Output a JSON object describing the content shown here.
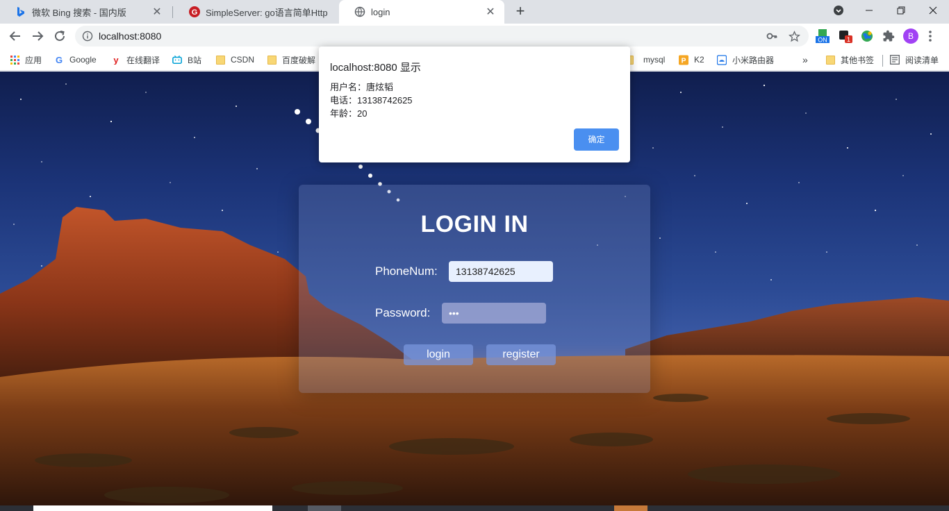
{
  "tabs": [
    {
      "title": "微软 Bing 搜索 - 国内版"
    },
    {
      "title": "SimpleServer: go语言简单Http"
    },
    {
      "title": "login"
    }
  ],
  "toolbar": {
    "url": "localhost:8080"
  },
  "bookmarks": [
    "应用",
    "Google",
    "在线翻译",
    "B站",
    "CSDN",
    "百度破解",
    "mysql",
    "K2",
    "小米路由器",
    "其他书签",
    "阅读清单"
  ],
  "extensions": {
    "on_badge": "ON",
    "notif_count": "1",
    "profile_initial": "B"
  },
  "dialog": {
    "title": "localhost:8080 显示",
    "lines": [
      "用户名：唐炫韬",
      "电话：13138742625",
      "年龄：20"
    ],
    "ok_label": "确定"
  },
  "login": {
    "title": "LOGIN IN",
    "phone_label": "PhoneNum:",
    "phone_value": "13138742625",
    "password_label": "Password:",
    "password_value": "•••",
    "login_button": "login",
    "register_button": "register"
  }
}
